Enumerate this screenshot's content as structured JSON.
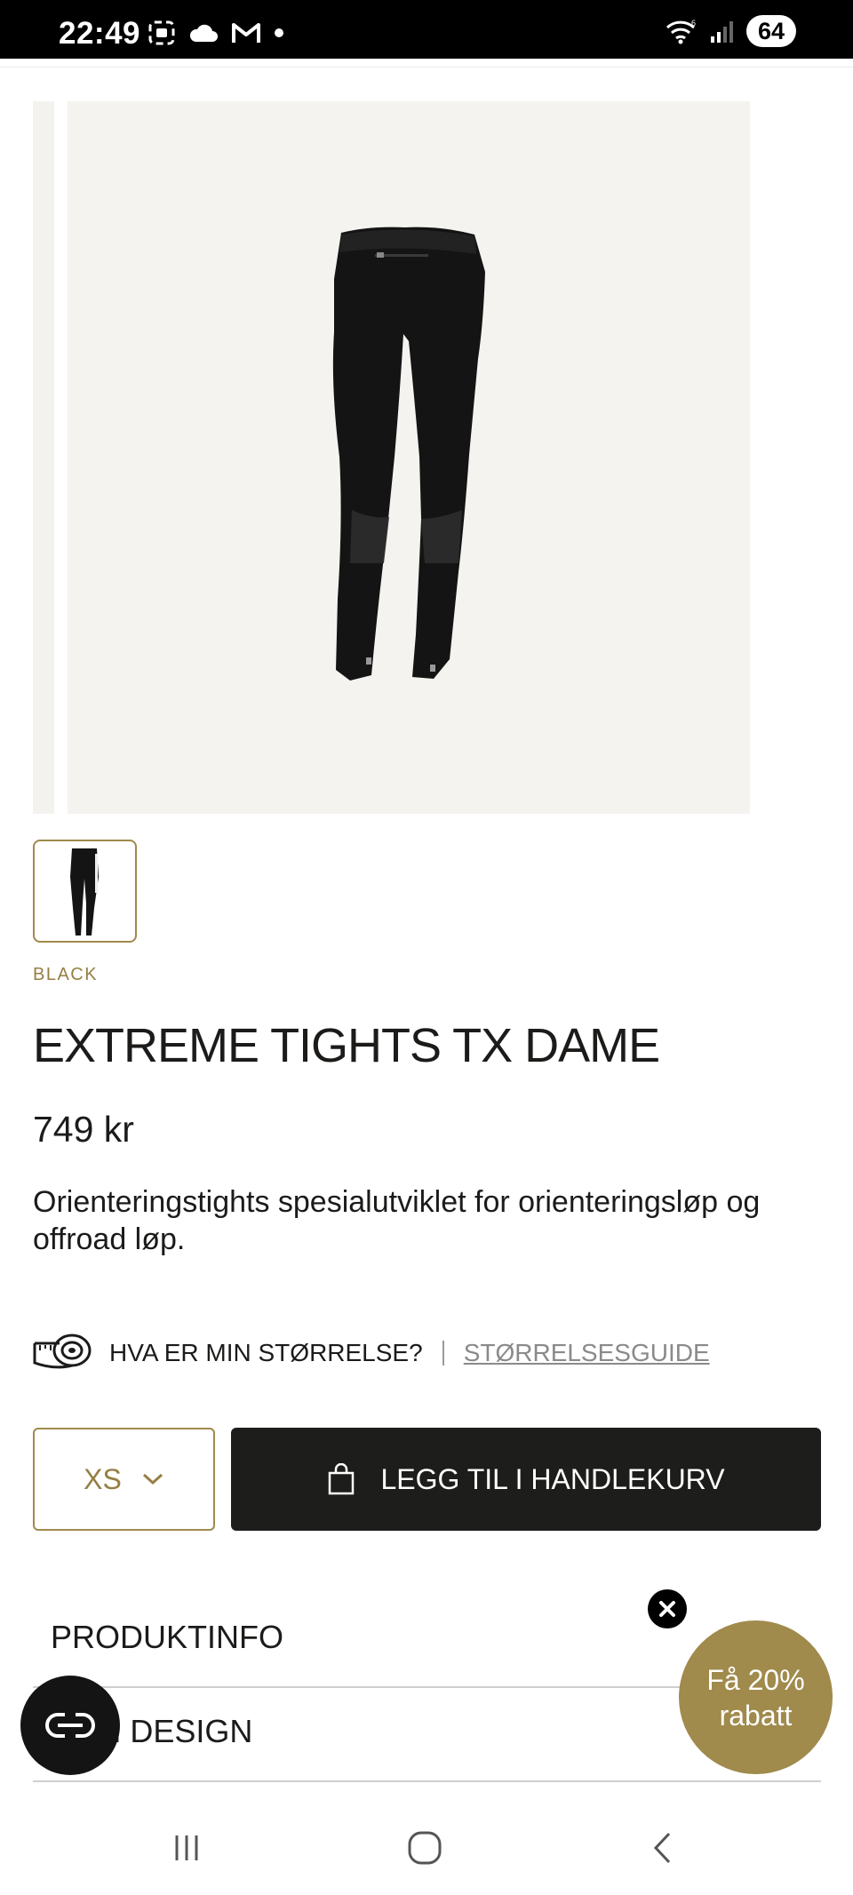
{
  "status_bar": {
    "time": "22:49",
    "battery": "64",
    "left_icons": [
      "screenshot-icon",
      "cloud-icon",
      "gmail-icon",
      "dot-icon"
    ],
    "right_icons": [
      "wifi-icon",
      "signal-icon",
      "battery-icon"
    ]
  },
  "product": {
    "color": "BLACK",
    "title": "EXTREME TIGHTS TX DAME",
    "price": "749 kr",
    "description": "Orienteringstights spesialutviklet for orienteringsløp og offroad løp."
  },
  "size_help": {
    "question": "HVA ER MIN STØRRELSE?",
    "separator": "|",
    "guide_link": "STØRRELSESGUIDE",
    "icon": "measuring-tape-icon"
  },
  "purchase": {
    "selected_size": "XS",
    "add_to_cart": "LEGG TIL I HANDLEKURV"
  },
  "accordion": {
    "items": [
      {
        "label": "PRODUKTINFO"
      },
      {
        "label": "TOM DESIGN"
      }
    ]
  },
  "promo": {
    "line1": "Få 20%",
    "line2": "rabatt"
  },
  "colors": {
    "gold": "#a08a4c",
    "dark_button": "#1d1d1b",
    "image_bg": "#f4f3ef"
  }
}
